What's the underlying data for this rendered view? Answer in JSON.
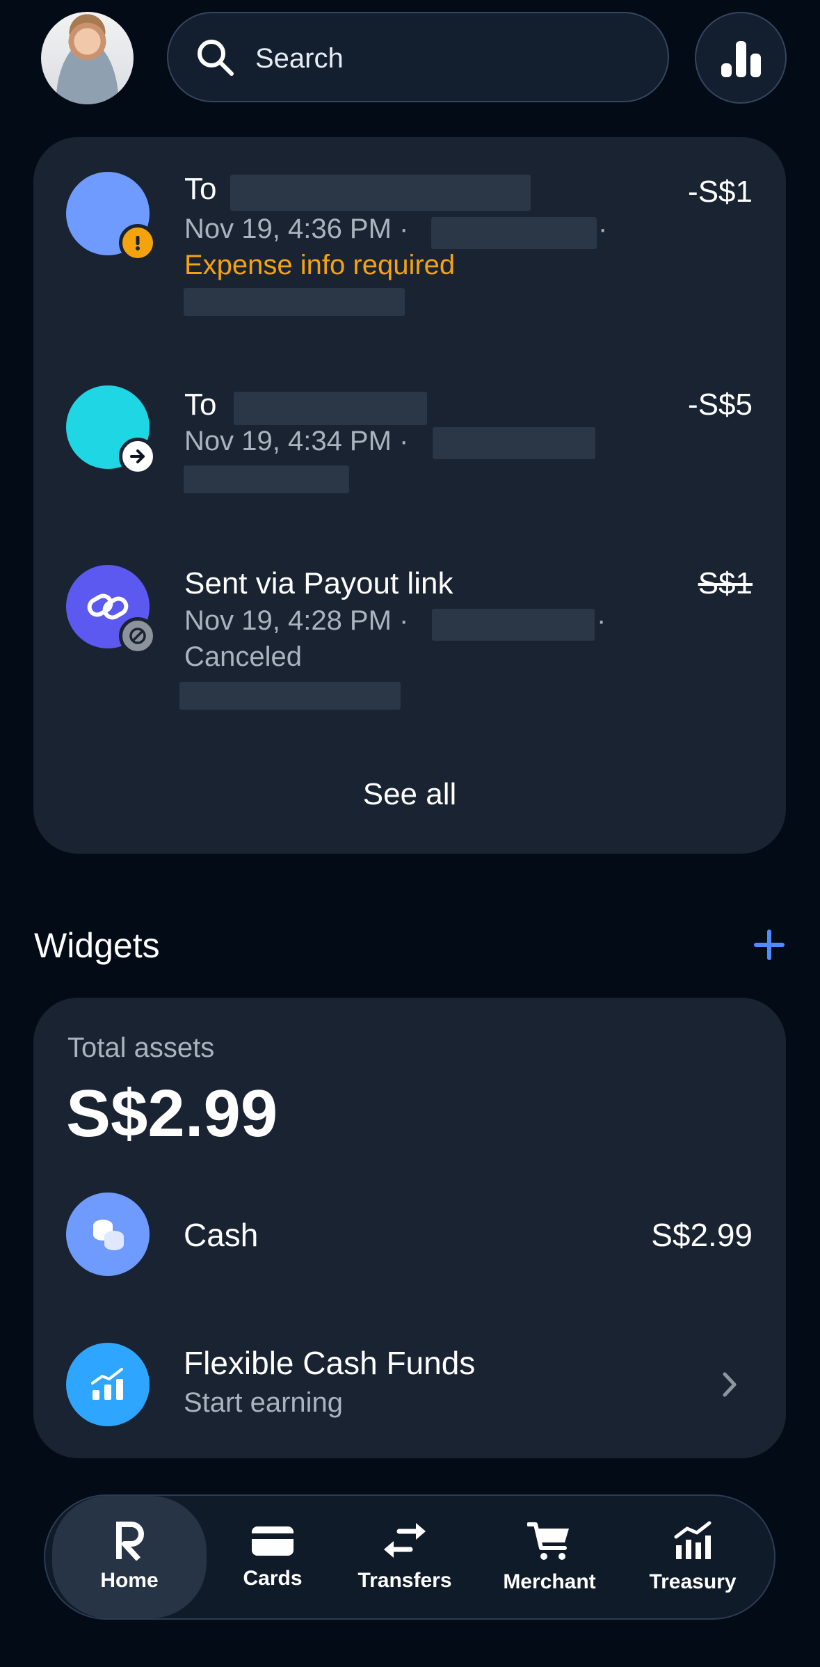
{
  "header": {
    "search_placeholder": "Search"
  },
  "transactions": [
    {
      "title": "To",
      "date": "Nov 19, 4:36 PM ·",
      "status": "Expense info required",
      "amount": "-S$1",
      "avatar_color": "#6f9bff",
      "badge": "warning-icon"
    },
    {
      "title": "To",
      "date": "Nov 19, 4:34 PM ·",
      "status": "",
      "amount": "-S$5",
      "avatar_color": "#1fd6e4",
      "badge": "arrow-right-icon"
    },
    {
      "title": "Sent via Payout link",
      "date": "Nov 19, 4:28 PM ·",
      "status": "Canceled",
      "amount": "S$1",
      "avatar_color": "#5b59f0",
      "badge": "canceled-icon"
    }
  ],
  "see_all": "See all",
  "widgets": {
    "title": "Widgets",
    "total_assets_label": "Total assets",
    "total_assets_value": "S$2.99",
    "items": [
      {
        "name": "Cash",
        "value": "S$2.99"
      },
      {
        "name": "Flexible Cash Funds",
        "subtitle": "Start earning"
      }
    ]
  },
  "nav": [
    {
      "label": "Home",
      "icon": "revolut-r-icon",
      "active": true
    },
    {
      "label": "Cards",
      "icon": "card-icon"
    },
    {
      "label": "Transfers",
      "icon": "transfers-icon"
    },
    {
      "label": "Merchant",
      "icon": "cart-icon"
    },
    {
      "label": "Treasury",
      "icon": "treasury-icon"
    }
  ],
  "colors": {
    "background": "#030b17",
    "card": "#192331",
    "warning": "#f5a30c",
    "accent": "#4f8dff"
  }
}
